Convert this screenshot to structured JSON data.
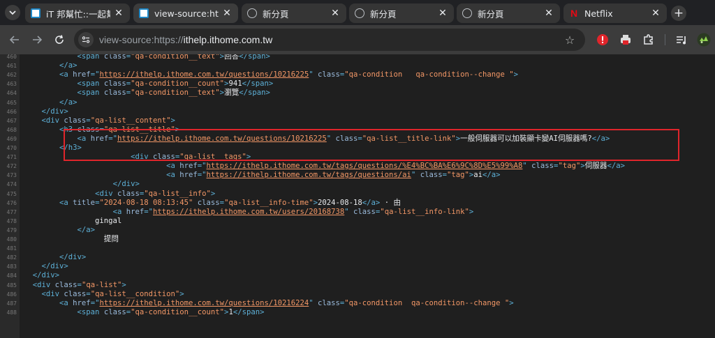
{
  "tabs": [
    {
      "title": "iT 邦幫忙::一起幫忙解",
      "favicon": "ithome-icon",
      "active": false
    },
    {
      "title": "view-source:https://",
      "favicon": "ithome-icon",
      "active": true
    },
    {
      "title": "新分頁",
      "favicon": "globe-icon",
      "active": false
    },
    {
      "title": "新分頁",
      "favicon": "globe-icon",
      "active": false
    },
    {
      "title": "新分頁",
      "favicon": "globe-icon",
      "active": false
    },
    {
      "title": "Netflix",
      "favicon": "netflix-icon",
      "active": false
    }
  ],
  "toolbar": {
    "url_prefix": "view-source:https://",
    "url_host": "ithelp.ithome.com.tw"
  },
  "icons": {
    "tab_search": "chevron-down-icon",
    "new_tab": "plus-icon",
    "back": "arrow-left-icon",
    "forward": "arrow-right-icon",
    "reload": "reload-icon",
    "site_info": "site-info-icon",
    "bookmark": "star-icon",
    "extension1": "adblock-extension-icon",
    "extension2": "printer-extension-icon",
    "extensions": "puzzle-icon",
    "reading_list": "reading-list-icon",
    "profile": "avatar-icon"
  },
  "colors": {
    "tag": "#5db0d7",
    "attribute": "#9bbbdc",
    "value": "#f29766",
    "highlight_border": "#e0252b"
  },
  "source_lines": [
    {
      "num": "460",
      "tokens": [
        [
          "text",
          "            "
        ],
        [
          "tag",
          "<span "
        ],
        [
          "attr",
          "class"
        ],
        [
          "tag",
          "="
        ],
        [
          "val",
          "\"qa-condition__text\""
        ],
        [
          "tag",
          ">"
        ],
        [
          "text",
          "回答"
        ],
        [
          "tag",
          "</span>"
        ]
      ]
    },
    {
      "num": "461",
      "tokens": [
        [
          "text",
          "        "
        ],
        [
          "tag",
          "</a>"
        ]
      ]
    },
    {
      "num": "462",
      "tokens": [
        [
          "text",
          "        "
        ],
        [
          "tag",
          "<a "
        ],
        [
          "attr",
          "href"
        ],
        [
          "tag",
          "="
        ],
        [
          "tag",
          "\""
        ],
        [
          "link",
          "https://ithelp.ithome.com.tw/questions/10216225"
        ],
        [
          "tag",
          "\" "
        ],
        [
          "attr",
          "class"
        ],
        [
          "tag",
          "="
        ],
        [
          "val",
          "\"qa-condition   qa-condition--change \""
        ],
        [
          "tag",
          ">"
        ]
      ]
    },
    {
      "num": "463",
      "tokens": [
        [
          "text",
          "            "
        ],
        [
          "tag",
          "<span "
        ],
        [
          "attr",
          "class"
        ],
        [
          "tag",
          "="
        ],
        [
          "val",
          "\"qa-condition__count\""
        ],
        [
          "tag",
          ">"
        ],
        [
          "text",
          "941"
        ],
        [
          "tag",
          "</span>"
        ]
      ]
    },
    {
      "num": "464",
      "tokens": [
        [
          "text",
          "            "
        ],
        [
          "tag",
          "<span "
        ],
        [
          "attr",
          "class"
        ],
        [
          "tag",
          "="
        ],
        [
          "val",
          "\"qa-condition__text\""
        ],
        [
          "tag",
          ">"
        ],
        [
          "text",
          "瀏覽"
        ],
        [
          "tag",
          "</span>"
        ]
      ]
    },
    {
      "num": "465",
      "tokens": [
        [
          "text",
          "        "
        ],
        [
          "tag",
          "</a>"
        ]
      ]
    },
    {
      "num": "466",
      "tokens": [
        [
          "text",
          "    "
        ],
        [
          "tag",
          "</div>"
        ]
      ]
    },
    {
      "num": "467",
      "tokens": [
        [
          "text",
          "    "
        ],
        [
          "tag",
          "<div "
        ],
        [
          "attr",
          "class"
        ],
        [
          "tag",
          "="
        ],
        [
          "val",
          "\"qa-list__content\""
        ],
        [
          "tag",
          ">"
        ]
      ]
    },
    {
      "num": "468",
      "tokens": [
        [
          "text",
          "        "
        ],
        [
          "tag",
          "<h3 "
        ],
        [
          "attr",
          "class"
        ],
        [
          "tag",
          "="
        ],
        [
          "val",
          "\"qa-list__title\""
        ],
        [
          "tag",
          ">"
        ]
      ]
    },
    {
      "num": "469",
      "tokens": [
        [
          "text",
          "            "
        ],
        [
          "tag",
          "<a "
        ],
        [
          "attr",
          "href"
        ],
        [
          "tag",
          "="
        ],
        [
          "tag",
          "\""
        ],
        [
          "link",
          "https://ithelp.ithome.com.tw/questions/10216225"
        ],
        [
          "tag",
          "\" "
        ],
        [
          "attr",
          "class"
        ],
        [
          "tag",
          "="
        ],
        [
          "val",
          "\"qa-list__title-link\""
        ],
        [
          "tag",
          ">"
        ],
        [
          "text",
          "一般伺服器可以加裝顯卡變AI伺服器嗎?"
        ],
        [
          "tag",
          "</a>"
        ]
      ]
    },
    {
      "num": "470",
      "tokens": [
        [
          "text",
          "        "
        ],
        [
          "tag",
          "</h3>"
        ]
      ]
    },
    {
      "num": "471",
      "tokens": [
        [
          "text",
          "                        "
        ],
        [
          "tag",
          "<div "
        ],
        [
          "attr",
          "class"
        ],
        [
          "tag",
          "="
        ],
        [
          "val",
          "\"qa-list__tags\""
        ],
        [
          "tag",
          ">"
        ]
      ]
    },
    {
      "num": "472",
      "tokens": [
        [
          "text",
          "                                "
        ],
        [
          "tag",
          "<a "
        ],
        [
          "attr",
          "href"
        ],
        [
          "tag",
          "="
        ],
        [
          "tag",
          "\""
        ],
        [
          "link",
          "https://ithelp.ithome.com.tw/tags/questions/%E4%BC%BA%E6%9C%8D%E5%99%A8"
        ],
        [
          "tag",
          "\" "
        ],
        [
          "attr",
          "class"
        ],
        [
          "tag",
          "="
        ],
        [
          "val",
          "\"tag\""
        ],
        [
          "tag",
          ">"
        ],
        [
          "text",
          "伺服器"
        ],
        [
          "tag",
          "</a>"
        ]
      ]
    },
    {
      "num": "473",
      "tokens": [
        [
          "text",
          "                                "
        ],
        [
          "tag",
          "<a "
        ],
        [
          "attr",
          "href"
        ],
        [
          "tag",
          "="
        ],
        [
          "tag",
          "\""
        ],
        [
          "link",
          "https://ithelp.ithome.com.tw/tags/questions/ai"
        ],
        [
          "tag",
          "\" "
        ],
        [
          "attr",
          "class"
        ],
        [
          "tag",
          "="
        ],
        [
          "val",
          "\"tag\""
        ],
        [
          "tag",
          ">"
        ],
        [
          "text",
          "ai"
        ],
        [
          "tag",
          "</a>"
        ]
      ]
    },
    {
      "num": "474",
      "tokens": [
        [
          "text",
          "                    "
        ],
        [
          "tag",
          "</div>"
        ]
      ]
    },
    {
      "num": "475",
      "tokens": [
        [
          "text",
          "                "
        ],
        [
          "tag",
          "<div "
        ],
        [
          "attr",
          "class"
        ],
        [
          "tag",
          "="
        ],
        [
          "val",
          "\"qa-list__info\""
        ],
        [
          "tag",
          ">"
        ]
      ]
    },
    {
      "num": "476",
      "tokens": [
        [
          "text",
          "        "
        ],
        [
          "tag",
          "<a "
        ],
        [
          "attr",
          "title"
        ],
        [
          "tag",
          "="
        ],
        [
          "val",
          "\"2024-08-18 08:13:45\""
        ],
        [
          "tag",
          " "
        ],
        [
          "attr",
          "class"
        ],
        [
          "tag",
          "="
        ],
        [
          "val",
          "\"qa-list__info-time\""
        ],
        [
          "tag",
          ">"
        ],
        [
          "text",
          "2024-08-18"
        ],
        [
          "tag",
          "</a>"
        ],
        [
          "text",
          " · 由"
        ]
      ]
    },
    {
      "num": "477",
      "tokens": [
        [
          "text",
          "                    "
        ],
        [
          "tag",
          "<a "
        ],
        [
          "attr",
          "href"
        ],
        [
          "tag",
          "="
        ],
        [
          "tag",
          "\""
        ],
        [
          "link",
          "https://ithelp.ithome.com.tw/users/20168738"
        ],
        [
          "tag",
          "\" "
        ],
        [
          "attr",
          "class"
        ],
        [
          "tag",
          "="
        ],
        [
          "val",
          "\"qa-list__info-link\""
        ],
        [
          "tag",
          ">"
        ]
      ]
    },
    {
      "num": "478",
      "tokens": [
        [
          "text",
          "                gingal"
        ]
      ]
    },
    {
      "num": "479",
      "tokens": [
        [
          "text",
          "            "
        ],
        [
          "tag",
          "</a>"
        ]
      ]
    },
    {
      "num": "480",
      "tokens": [
        [
          "text",
          "                  提問"
        ]
      ]
    },
    {
      "num": "481",
      "tokens": [
        [
          "text",
          ""
        ]
      ]
    },
    {
      "num": "482",
      "tokens": [
        [
          "text",
          "        "
        ],
        [
          "tag",
          "</div>"
        ]
      ]
    },
    {
      "num": "483",
      "tokens": [
        [
          "text",
          "    "
        ],
        [
          "tag",
          "</div>"
        ]
      ]
    },
    {
      "num": "484",
      "tokens": [
        [
          "text",
          "  "
        ],
        [
          "tag",
          "</div>"
        ]
      ]
    },
    {
      "num": "485",
      "tokens": [
        [
          "text",
          "  "
        ],
        [
          "tag",
          "<div "
        ],
        [
          "attr",
          "class"
        ],
        [
          "tag",
          "="
        ],
        [
          "val",
          "\"qa-list\""
        ],
        [
          "tag",
          ">"
        ]
      ]
    },
    {
      "num": "486",
      "tokens": [
        [
          "text",
          "    "
        ],
        [
          "tag",
          "<div "
        ],
        [
          "attr",
          "class"
        ],
        [
          "tag",
          "="
        ],
        [
          "val",
          "\"qa-list__condition\""
        ],
        [
          "tag",
          ">"
        ]
      ]
    },
    {
      "num": "487",
      "tokens": [
        [
          "text",
          "        "
        ],
        [
          "tag",
          "<a "
        ],
        [
          "attr",
          "href"
        ],
        [
          "tag",
          "="
        ],
        [
          "tag",
          "\""
        ],
        [
          "link",
          "https://ithelp.ithome.com.tw/questions/10216224"
        ],
        [
          "tag",
          "\" "
        ],
        [
          "attr",
          "class"
        ],
        [
          "tag",
          "="
        ],
        [
          "val",
          "\"qa-condition  qa-condition--change \""
        ],
        [
          "tag",
          ">"
        ]
      ]
    },
    {
      "num": "488",
      "tokens": [
        [
          "text",
          "            "
        ],
        [
          "tag",
          "<span "
        ],
        [
          "attr",
          "class"
        ],
        [
          "tag",
          "="
        ],
        [
          "val",
          "\"qa-condition__count\""
        ],
        [
          "tag",
          ">"
        ],
        [
          "text",
          "1"
        ],
        [
          "tag",
          "</span>"
        ]
      ]
    }
  ]
}
